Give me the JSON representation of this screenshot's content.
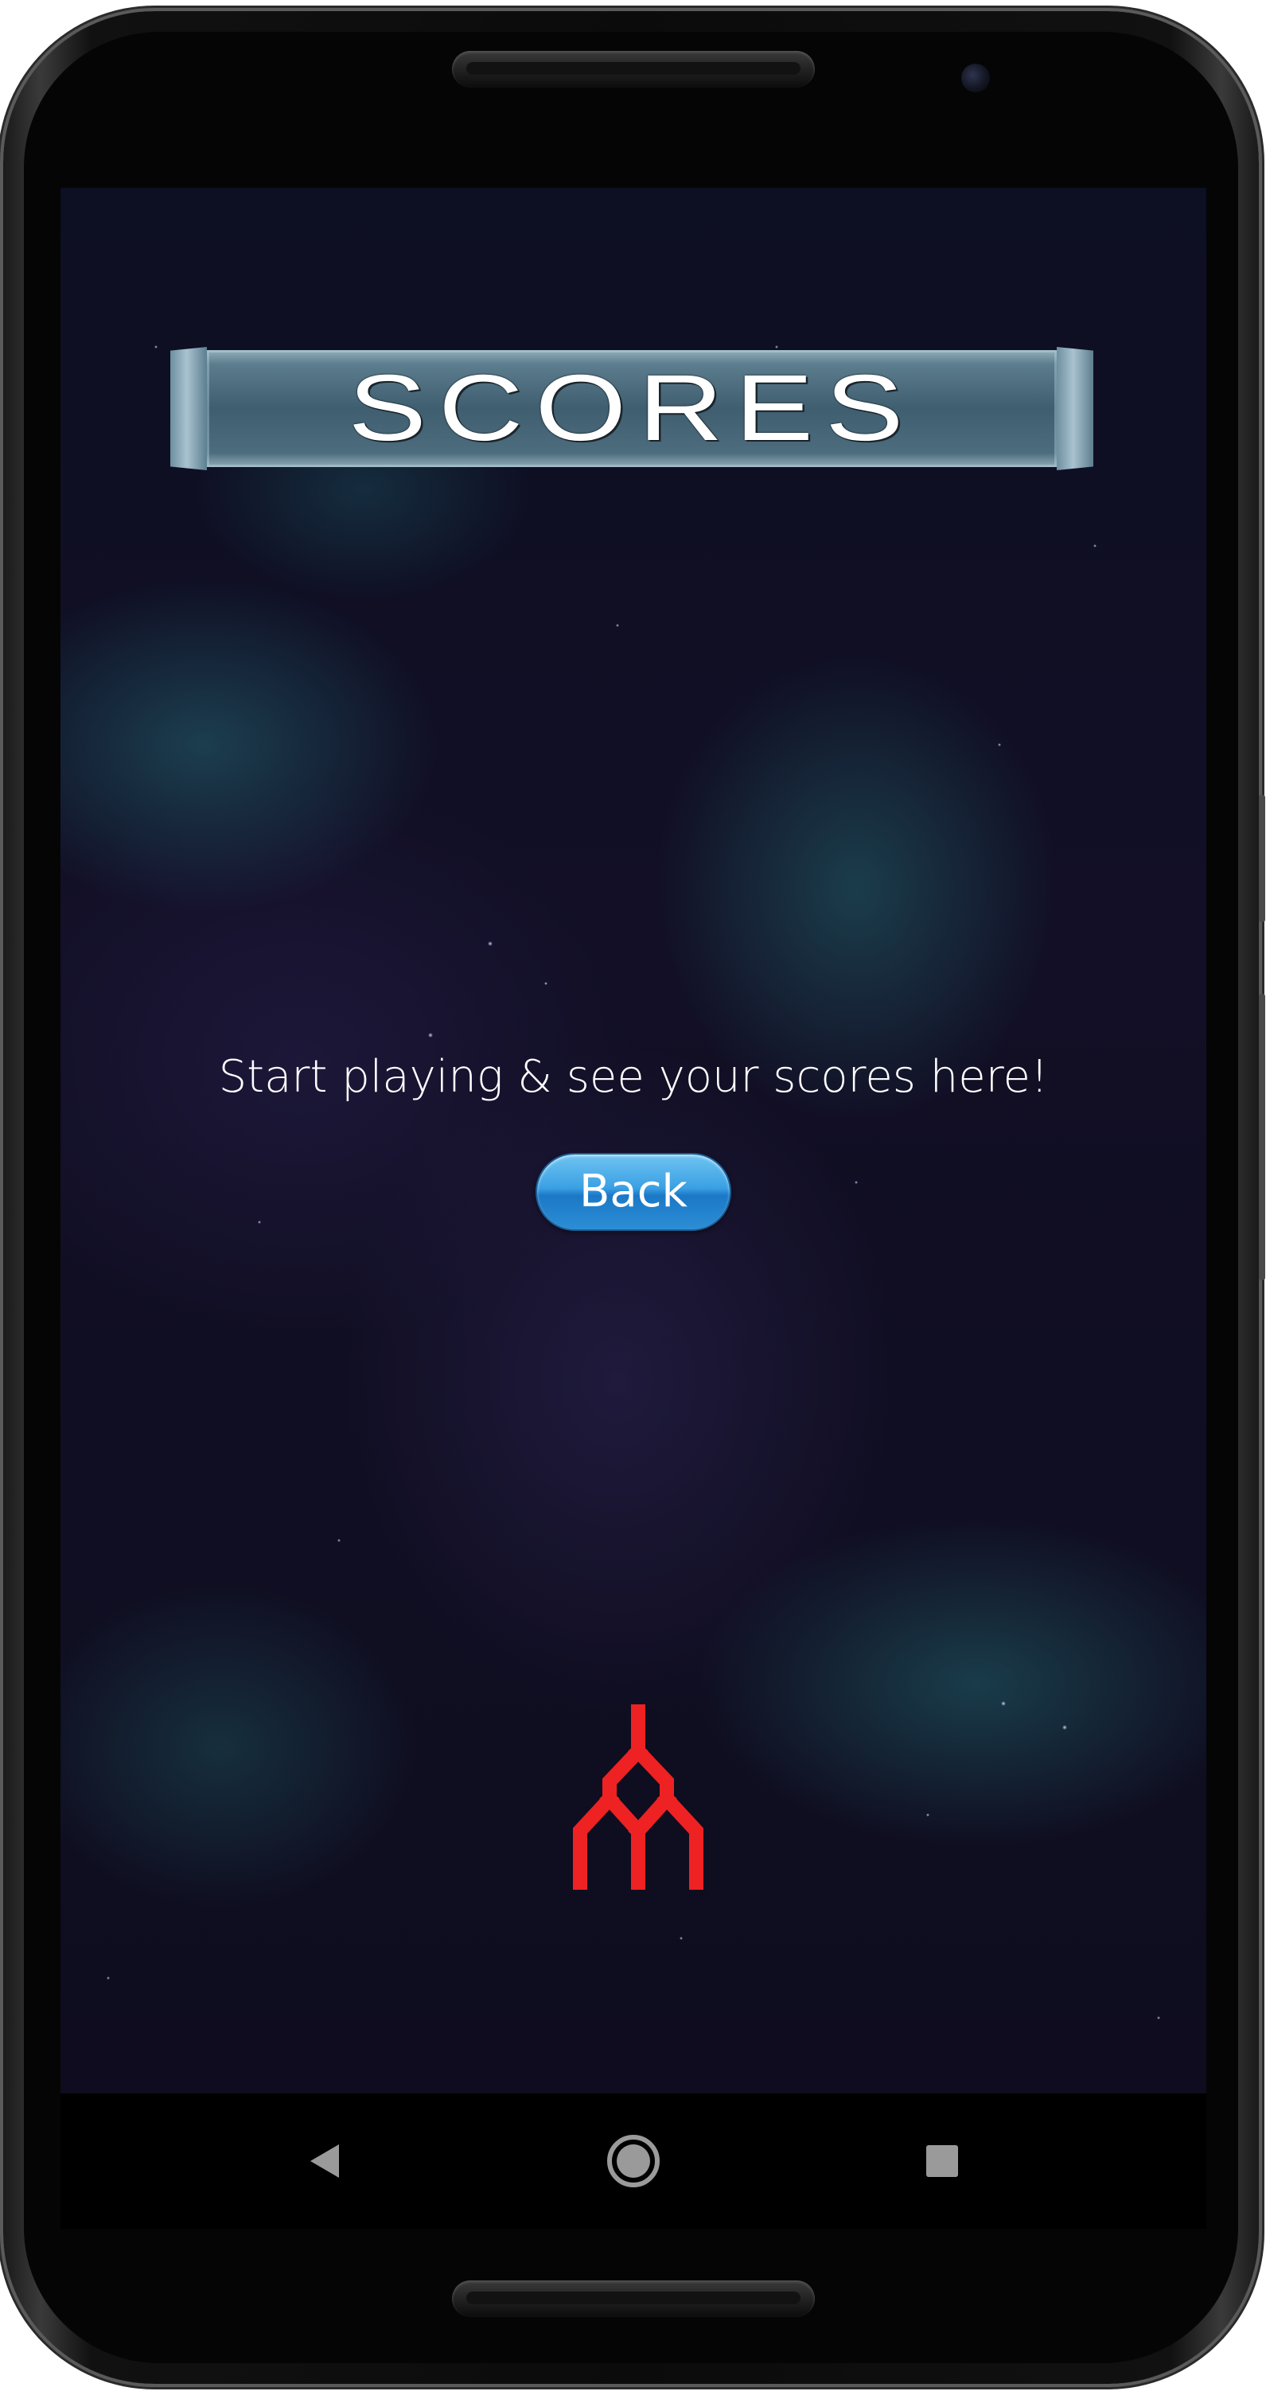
{
  "screen": {
    "title": "SCORES",
    "message": "Start playing & see your scores here!",
    "back_label": "Back"
  },
  "navigation": {
    "back": "back-icon",
    "home": "home-icon",
    "recents": "recents-icon"
  },
  "colors": {
    "ship": "#ee2222",
    "button": "#2c8ed6",
    "title_plate": "#4d6d7e"
  }
}
